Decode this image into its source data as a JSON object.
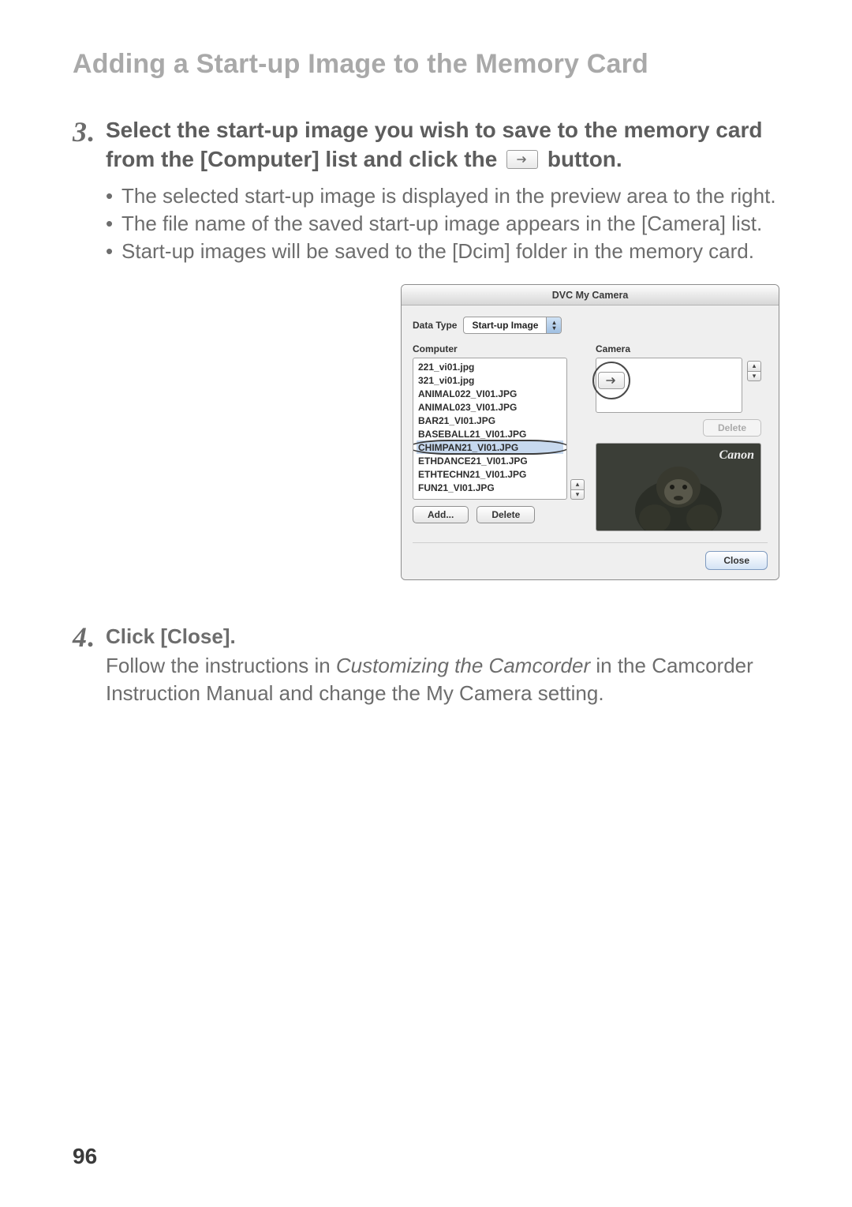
{
  "page": {
    "section_title": "Adding a Start-up Image to the Memory Card",
    "page_number": "96"
  },
  "step3": {
    "number": "3",
    "heading_before_icon": "Select the start-up image you wish to save to the memory card from the [Computer] list and click the ",
    "heading_after_icon": " button.",
    "bullets": [
      "The selected start-up image is displayed in the preview area to the right.",
      "The file name of the saved start-up image appears in the [Camera] list.",
      "Start-up images will be saved to the [Dcim] folder in the memory card."
    ]
  },
  "step4": {
    "number": "4",
    "heading": "Click [Close].",
    "body_prefix": "Follow the instructions in ",
    "body_italic": "Customizing the Camcorder",
    "body_suffix": " in the Camcorder Instruction Manual and change the My Camera setting."
  },
  "window": {
    "title": "DVC My Camera",
    "data_type_label": "Data Type",
    "data_type_value": "Start-up Image",
    "computer_label": "Computer",
    "camera_label": "Camera",
    "computer_files": [
      "221_vi01.jpg",
      "321_vi01.jpg",
      "ANIMAL022_VI01.JPG",
      "ANIMAL023_VI01.JPG",
      "BAR21_VI01.JPG",
      "BASEBALL21_VI01.JPG",
      "CHIMPAN21_VI01.JPG",
      "ETHDANCE21_VI01.JPG",
      "ETHTECHN21_VI01.JPG",
      "FUN21_VI01.JPG"
    ],
    "selected_index": 6,
    "add_label": "Add...",
    "delete_label": "Delete",
    "camera_delete_label": "Delete",
    "preview_brand": "Canon",
    "close_label": "Close"
  }
}
